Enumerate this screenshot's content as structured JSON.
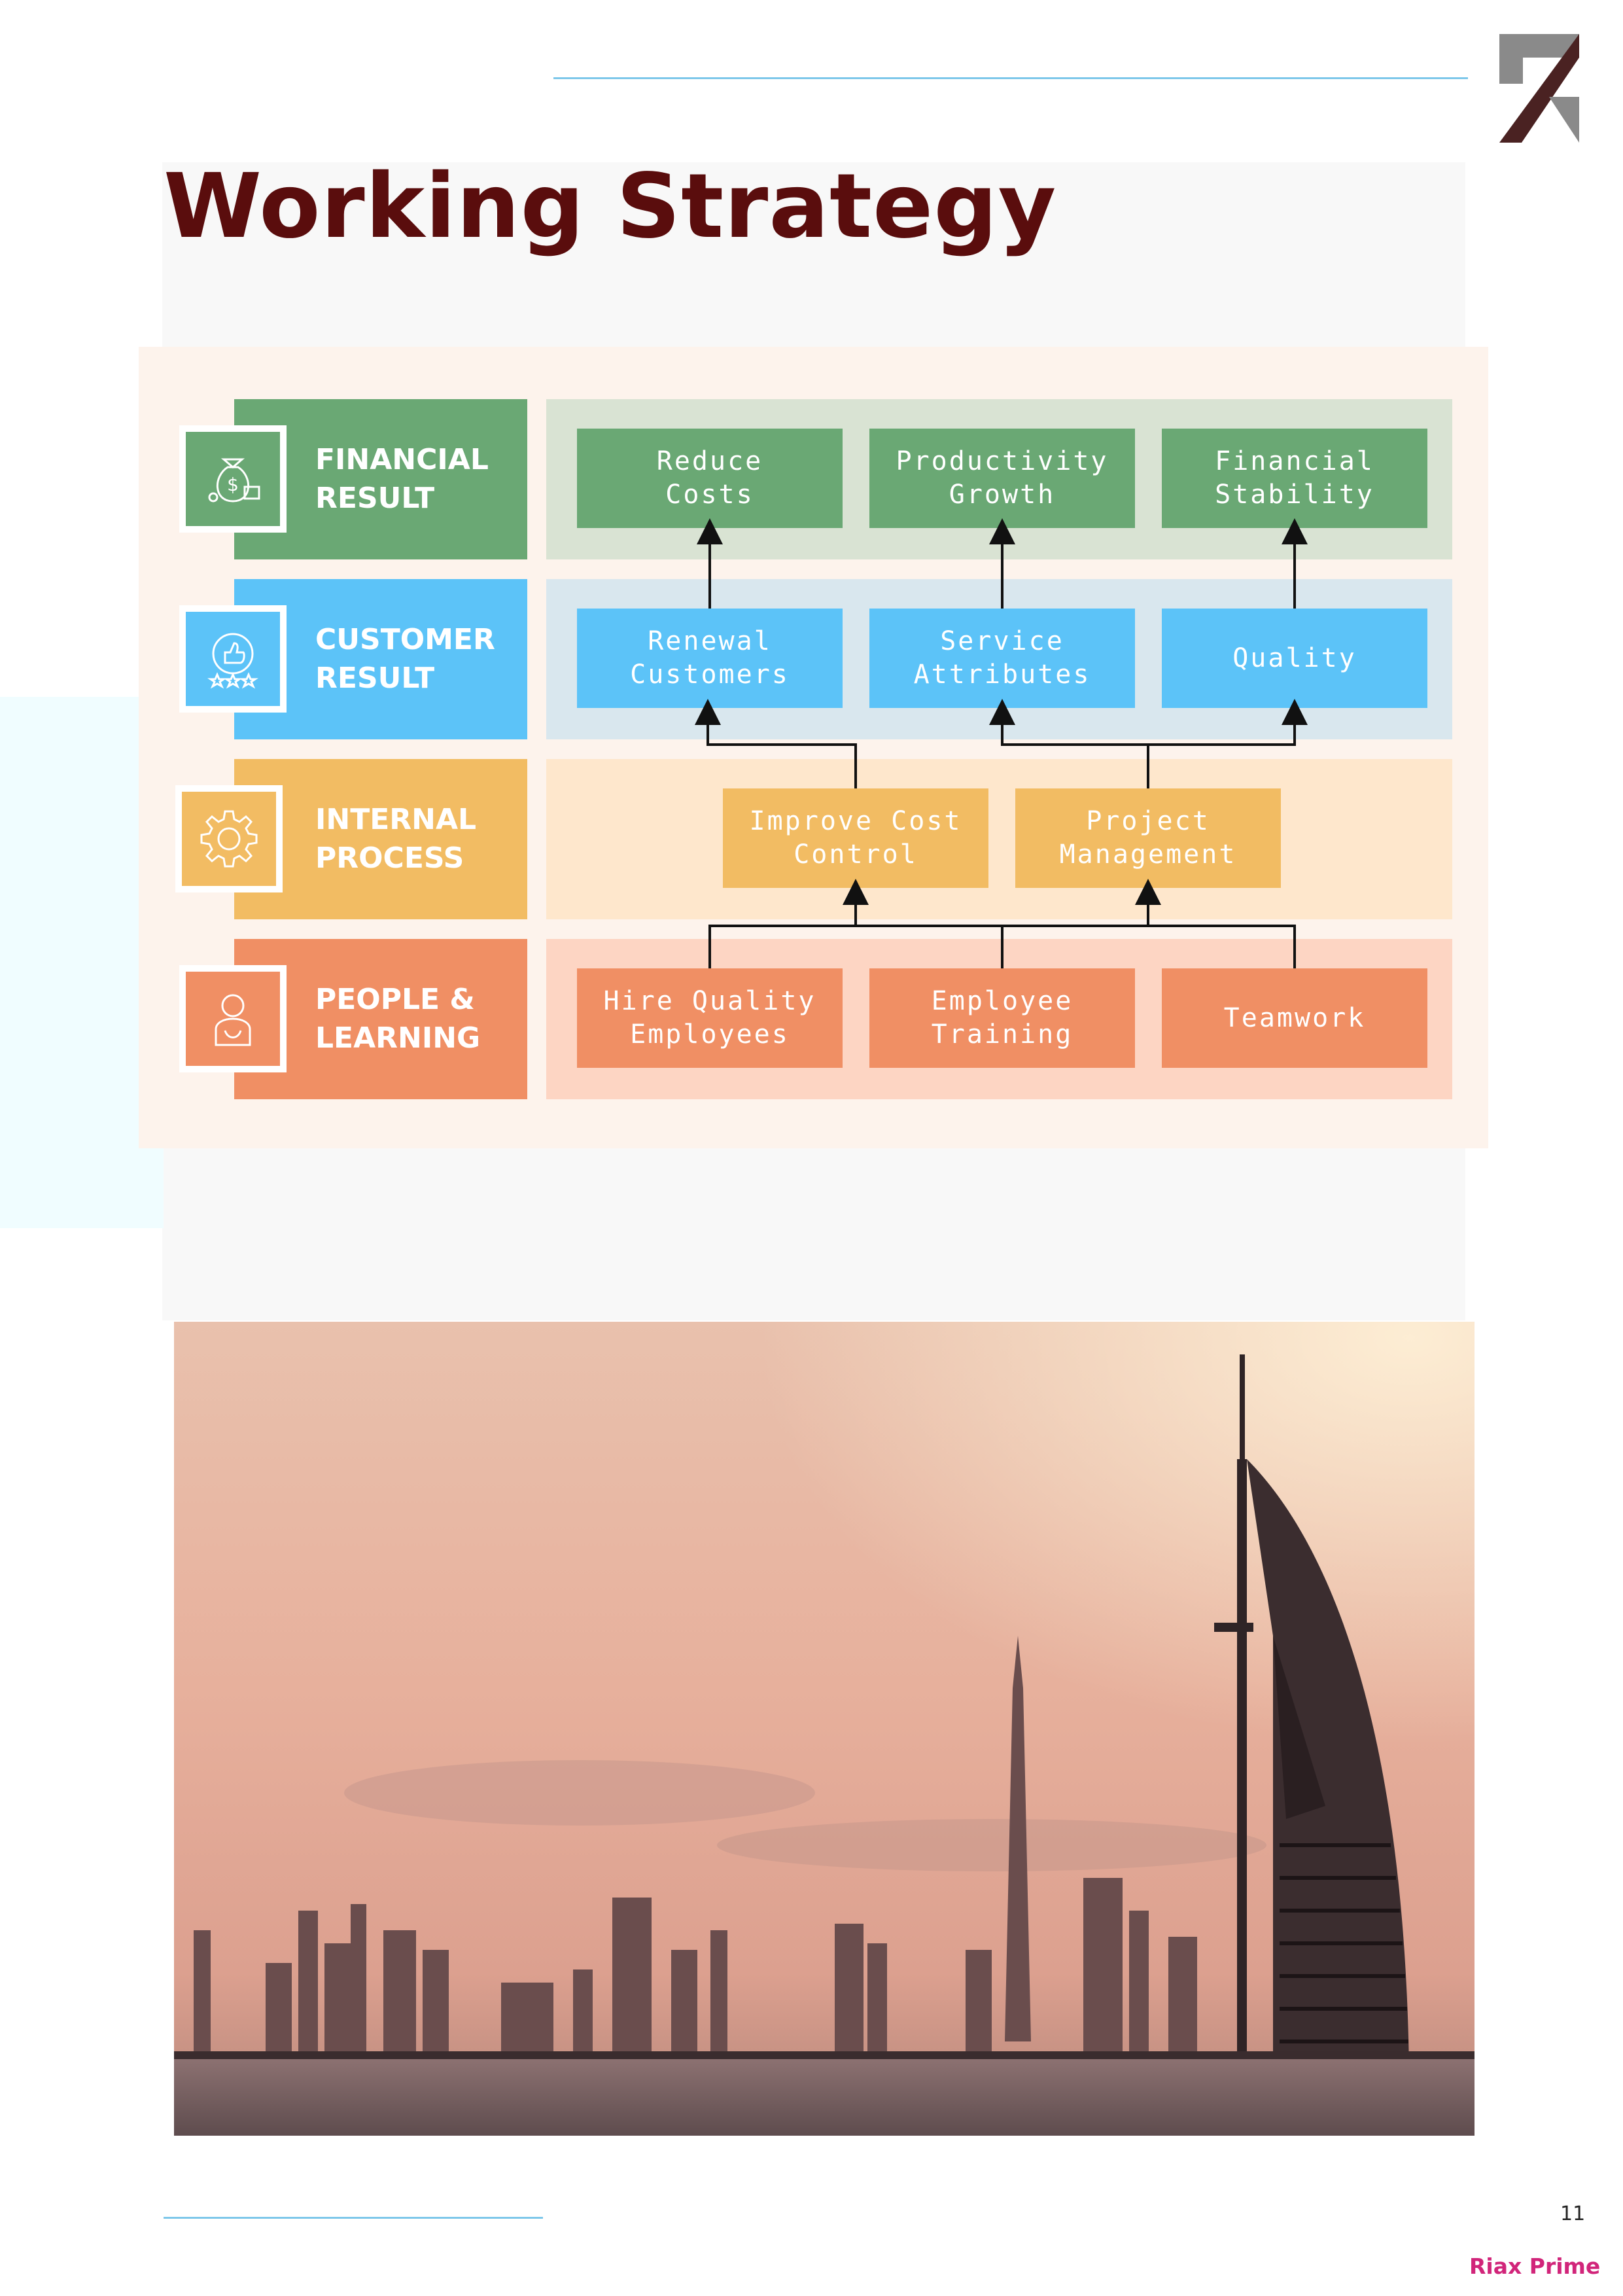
{
  "page": {
    "title": "Working Strategy",
    "page_number": "11",
    "brand": "Riax Prime"
  },
  "colors": {
    "title": "#5a0d0d",
    "green": "#6aa874",
    "green_band": "#d9e3d3",
    "blue": "#5cc3f8",
    "blue_band": "#d9e7ee",
    "yellow": "#f2bc63",
    "yellow_band": "#fee7cc",
    "orange": "#f08f64",
    "orange_band": "#fdd5c3",
    "panel": "#fdf3ec",
    "rule": "#7fc8ea",
    "brand": "#d1257a"
  },
  "strategy": {
    "rows": [
      {
        "label": "FINANCIAL\nRESULT",
        "icon": "money-bag-icon",
        "boxes": [
          "Reduce\nCosts",
          "Productivity\nGrowth",
          "Financial\nStability"
        ]
      },
      {
        "label": "CUSTOMER\nRESULT",
        "icon": "thumbs-up-rating-icon",
        "boxes": [
          "Renewal\nCustomers",
          "Service\nAttributes",
          "Quality"
        ]
      },
      {
        "label": "INTERNAL\nPROCESS",
        "icon": "gear-icon",
        "boxes": [
          "Improve Cost\nControl",
          "Project\nManagement"
        ]
      },
      {
        "label": "PEOPLE &\nLEARNING",
        "icon": "person-icon",
        "boxes": [
          "Hire Quality\nEmployees",
          "Employee\nTraining",
          "Teamwork"
        ]
      }
    ]
  }
}
